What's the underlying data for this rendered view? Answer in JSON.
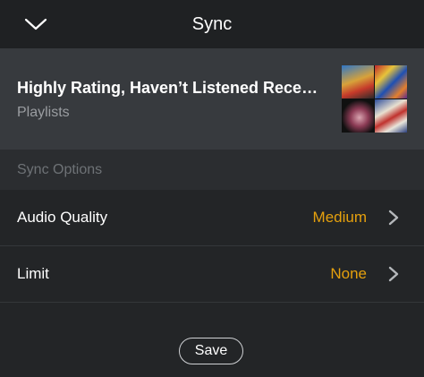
{
  "header": {
    "title": "Sync",
    "back_icon": "chevron-down-icon"
  },
  "playlist": {
    "title": "Highly Rating, Haven’t Listened Recen…",
    "subtitle": "Playlists",
    "cover_icon": "album-cover-collage"
  },
  "sync_options": {
    "section_label": "Sync Options",
    "rows": [
      {
        "label": "Audio Quality",
        "value": "Medium",
        "icon": "chevron-right-icon"
      },
      {
        "label": "Limit",
        "value": "None",
        "icon": "chevron-right-icon"
      }
    ]
  },
  "actions": {
    "save_label": "Save"
  },
  "colors": {
    "background": "#232527",
    "header": "#1f2123",
    "card": "#373a3e",
    "section": "#2b2d30",
    "accent": "#e5a00d",
    "text_primary": "#ffffff",
    "text_secondary": "#9a9da1",
    "text_muted": "#6e7276"
  }
}
